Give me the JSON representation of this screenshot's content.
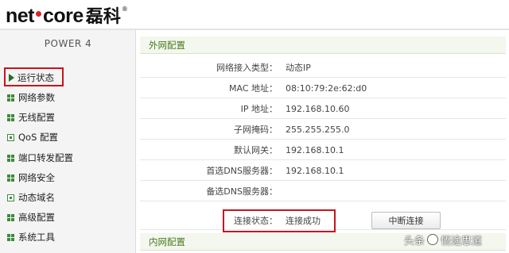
{
  "header": {
    "logo_latin_left": "net",
    "logo_latin_right": "core",
    "logo_chinese": "磊科",
    "logo_mark": "®"
  },
  "sidebar": {
    "model": "POWER 4",
    "items": [
      {
        "label": "运行状态",
        "icon": "arrow-icon",
        "active": true
      },
      {
        "label": "网络参数",
        "icon": "grid-icon"
      },
      {
        "label": "无线配置",
        "icon": "grid-icon"
      },
      {
        "label": "QoS 配置",
        "icon": "box-icon"
      },
      {
        "label": "端口转发配置",
        "icon": "grid-icon"
      },
      {
        "label": "网络安全",
        "icon": "grid-icon"
      },
      {
        "label": "动态域名",
        "icon": "box-icon"
      },
      {
        "label": "高级配置",
        "icon": "grid-icon"
      },
      {
        "label": "系统工具",
        "icon": "grid-icon"
      }
    ]
  },
  "wan": {
    "title": "外网配置",
    "rows": [
      {
        "label": "网络接入类型：",
        "value": "动态IP"
      },
      {
        "label": "MAC 地址：",
        "value": "08:10:79:2e:62:d0"
      },
      {
        "label": "IP 地址：",
        "value": "192.168.10.60"
      },
      {
        "label": "子网掩码：",
        "value": "255.255.255.0"
      },
      {
        "label": "默认网关：",
        "value": "192.168.10.1"
      },
      {
        "label": "首选DNS服务器：",
        "value": "192.168.10.1"
      },
      {
        "label": "备选DNS服务器：",
        "value": ""
      }
    ],
    "status_label": "连接状态：",
    "status_value": "连接成功",
    "disconnect_button": "中断连接"
  },
  "lan": {
    "title": "内网配置"
  },
  "watermark": {
    "left": "头条",
    "right": "悟途思道"
  },
  "colors": {
    "highlight_border": "#c8151b",
    "menu_icon_green": "#3d8a3a",
    "section_title_text": "#4a7a1e"
  }
}
